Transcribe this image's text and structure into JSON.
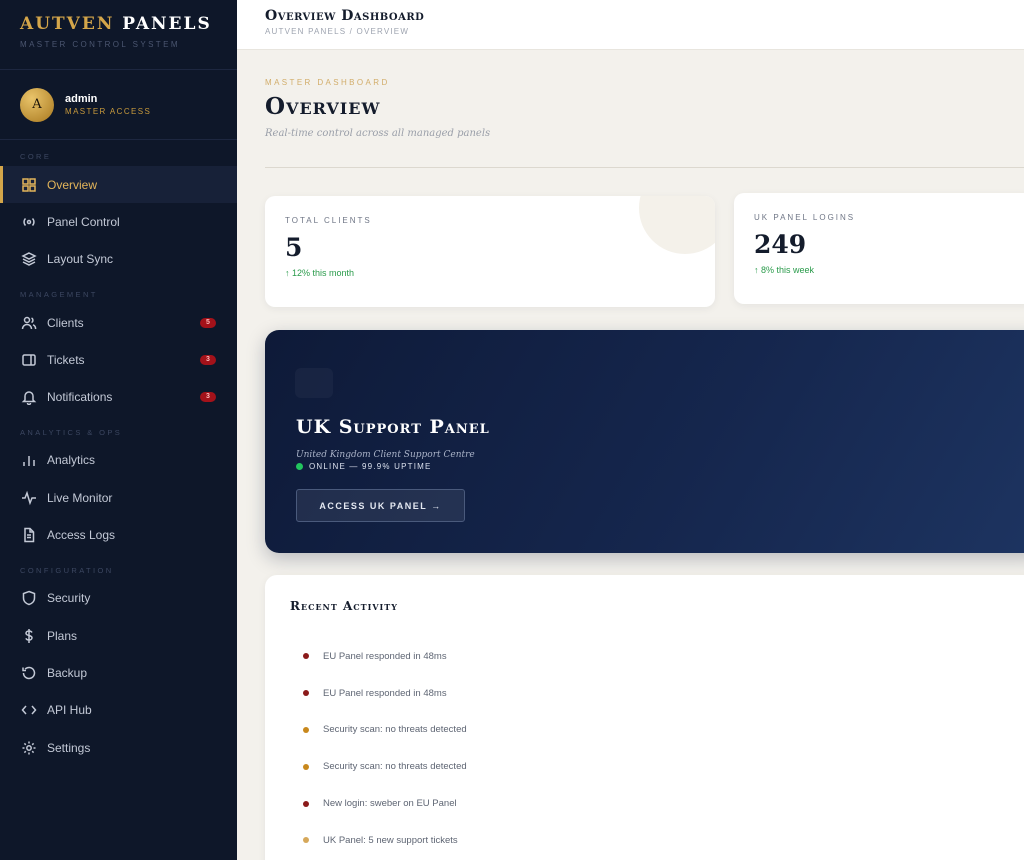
{
  "brand": {
    "title_part1": "AUTVEN",
    "title_part2": "PANELS",
    "subtitle": "Master Control System"
  },
  "user": {
    "initial": "A",
    "name": "admin",
    "role": "Master Access"
  },
  "nav": {
    "sections": [
      {
        "label": "Core",
        "items": [
          {
            "label": "Overview",
            "icon": "grid-icon",
            "active": true
          },
          {
            "label": "Panel Control",
            "icon": "broadcast-icon"
          },
          {
            "label": "Layout Sync",
            "icon": "layers-icon"
          }
        ]
      },
      {
        "label": "Management",
        "items": [
          {
            "label": "Clients",
            "icon": "users-icon",
            "badge": "5"
          },
          {
            "label": "Tickets",
            "icon": "ticket-icon",
            "badge": "3"
          },
          {
            "label": "Notifications",
            "icon": "bell-icon",
            "badge": "3"
          }
        ]
      },
      {
        "label": "Analytics & Ops",
        "items": [
          {
            "label": "Analytics",
            "icon": "bar-chart-icon"
          },
          {
            "label": "Live Monitor",
            "icon": "pulse-icon"
          },
          {
            "label": "Access Logs",
            "icon": "document-icon"
          }
        ]
      },
      {
        "label": "Configuration",
        "items": [
          {
            "label": "Security",
            "icon": "shield-icon"
          },
          {
            "label": "Plans",
            "icon": "dollar-icon"
          },
          {
            "label": "Backup",
            "icon": "history-icon"
          },
          {
            "label": "API Hub",
            "icon": "code-icon"
          },
          {
            "label": "Settings",
            "icon": "gear-icon"
          }
        ]
      }
    ]
  },
  "topbar": {
    "title": "Overview Dashboard",
    "breadcrumb": "Autven Panels / Overview"
  },
  "page": {
    "eyebrow": "Master Dashboard",
    "title": "Overview",
    "subtitle": "Real-time control across all managed panels"
  },
  "stats": [
    {
      "label": "Total Clients",
      "value": "5",
      "trend": "↑ 12% this month"
    },
    {
      "label": "UK Panel Logins",
      "value": "249",
      "trend": "↑ 8% this week"
    }
  ],
  "hero": {
    "title": "UK Support Panel",
    "subtitle": "United Kingdom Client Support Centre",
    "status": "Online — 99.9% Uptime",
    "button": "Access UK Panel →"
  },
  "activity": {
    "title": "Recent Activity",
    "items": [
      {
        "text": "EU Panel responded in 48ms",
        "color": "#8b1a1a"
      },
      {
        "text": "EU Panel responded in 48ms",
        "color": "#8b1a1a"
      },
      {
        "text": "Security scan: no threats detected",
        "color": "#c8881c"
      },
      {
        "text": "Security scan: no threats detected",
        "color": "#c8881c"
      },
      {
        "text": "New login: sweber on EU Panel",
        "color": "#8b1a1a"
      },
      {
        "text": "UK Panel: 5 new support tickets",
        "color": "#d6a85a"
      }
    ]
  },
  "colors": {
    "gold": "#d4a64a",
    "sidebar": "#0e1729",
    "success": "#2a9b4b"
  }
}
